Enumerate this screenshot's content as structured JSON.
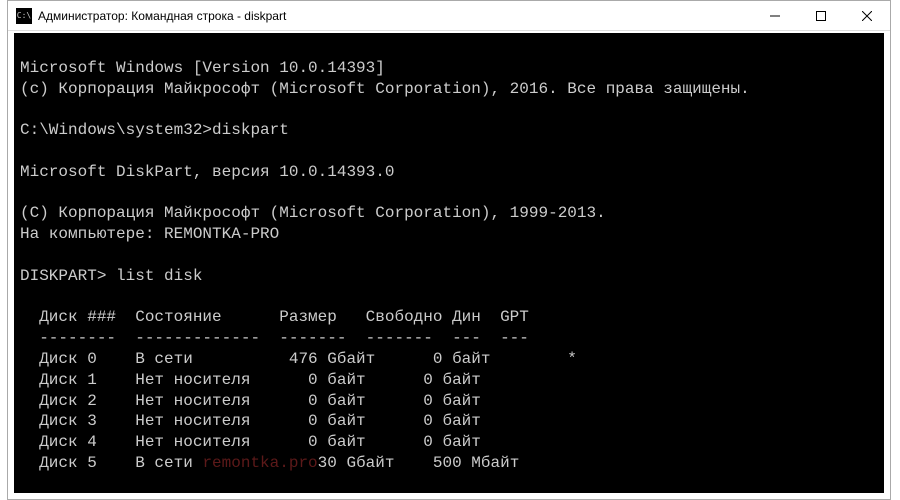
{
  "window": {
    "icon_text": "C:\\",
    "title": "Администратор: Командная строка - diskpart"
  },
  "console": {
    "lines": [
      "Microsoft Windows [Version 10.0.14393]",
      "(c) Корпорация Майкрософт (Microsoft Corporation), 2016. Все права защищены.",
      "",
      "C:\\Windows\\system32>diskpart",
      "",
      "Microsoft DiskPart, версия 10.0.14393.0",
      "",
      "(C) Корпорация Майкрософт (Microsoft Corporation), 1999-2013.",
      "На компьютере: REMONTKA-PRO",
      "",
      "DISKPART> list disk",
      "",
      "  Диск ###  Состояние      Размер   Свободно Дин  GPT",
      "  --------  -------------  -------  -------  ---  ---",
      "  Диск 0    В сети          476 Gбайт      0 байт        *",
      "  Диск 1    Нет носителя      0 байт      0 байт",
      "  Диск 2    Нет носителя      0 байт      0 байт",
      "  Диск 3    Нет носителя      0 байт      0 байт",
      "  Диск 4    Нет носителя      0 байт      0 байт"
    ],
    "watermark_line": {
      "prefix": "  Диск 5    В сети ",
      "watermark": "remontka.pro",
      "suffix": "30 Gбайт    500 Мбайт"
    }
  },
  "diskpart": {
    "prompt1": "C:\\Windows\\system32>",
    "command1": "diskpart",
    "prompt2": "DISKPART>",
    "command2": "list disk",
    "version_windows": "10.0.14393",
    "version_diskpart": "10.0.14393.0",
    "computer_name": "REMONTKA-PRO",
    "table": {
      "headers": [
        "Диск ###",
        "Состояние",
        "Размер",
        "Свободно",
        "Дин",
        "GPT"
      ],
      "rows": [
        {
          "disk": "Диск 0",
          "status": "В сети",
          "size": "476 Gбайт",
          "free": "0 байт",
          "dyn": "",
          "gpt": "*"
        },
        {
          "disk": "Диск 1",
          "status": "Нет носителя",
          "size": "0 байт",
          "free": "0 байт",
          "dyn": "",
          "gpt": ""
        },
        {
          "disk": "Диск 2",
          "status": "Нет носителя",
          "size": "0 байт",
          "free": "0 байт",
          "dyn": "",
          "gpt": ""
        },
        {
          "disk": "Диск 3",
          "status": "Нет носителя",
          "size": "0 байт",
          "free": "0 байт",
          "dyn": "",
          "gpt": ""
        },
        {
          "disk": "Диск 4",
          "status": "Нет носителя",
          "size": "0 байт",
          "free": "0 байт",
          "dyn": "",
          "gpt": ""
        },
        {
          "disk": "Диск 5",
          "status": "В сети",
          "size": "30 Gбайт",
          "free": "500 Мбайт",
          "dyn": "",
          "gpt": ""
        }
      ]
    }
  }
}
